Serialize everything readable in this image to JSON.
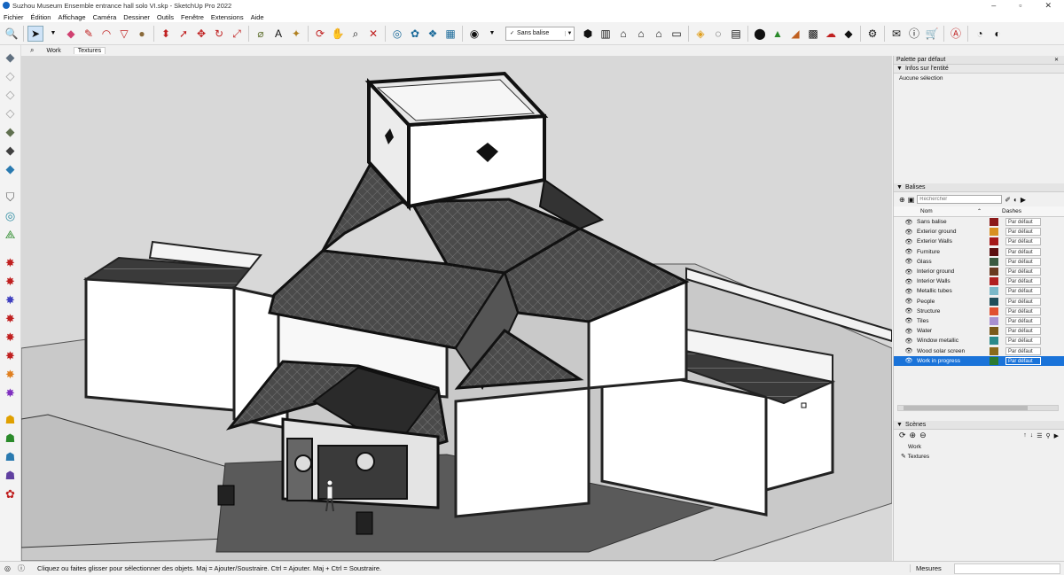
{
  "window": {
    "title": "Suzhou Museum Ensemble entrance hall solo VI.skp - SketchUp Pro 2022",
    "minimize": "–",
    "maximize": "▫",
    "close": "✕"
  },
  "menu": [
    "Fichier",
    "Édition",
    "Affichage",
    "Caméra",
    "Dessiner",
    "Outils",
    "Fenêtre",
    "Extensions",
    "Aide"
  ],
  "toolbar": {
    "tag_select_value": "Sans balise"
  },
  "tabs": [
    "Work",
    "Textures"
  ],
  "panel": {
    "title": "Palette par défaut",
    "entity_info": {
      "header": "Infos sur l'entité",
      "value": "Aucune sélection"
    },
    "tags": {
      "header": "Balises",
      "search_placeholder": "Rechercher",
      "col_name": "Nom",
      "col_dashes": "Dashes",
      "rows": [
        {
          "name": "Sans balise",
          "color": "#8b1a1a",
          "dashes": "Par défaut"
        },
        {
          "name": "Exterior ground",
          "color": "#d89020",
          "dashes": "Par défaut"
        },
        {
          "name": "Exterior Walls",
          "color": "#a51818",
          "dashes": "Par défaut"
        },
        {
          "name": "Furniture",
          "color": "#5c1010",
          "dashes": "Par défaut"
        },
        {
          "name": "Glass",
          "color": "#3a5a40",
          "dashes": "Par défaut"
        },
        {
          "name": "Interior ground",
          "color": "#6a3a20",
          "dashes": "Par défaut"
        },
        {
          "name": "Interior Walls",
          "color": "#b02020",
          "dashes": "Par défaut"
        },
        {
          "name": "Metallic tubes",
          "color": "#7ab8c8",
          "dashes": "Par défaut"
        },
        {
          "name": "People",
          "color": "#1f4e5a",
          "dashes": "Par défaut"
        },
        {
          "name": "Structure",
          "color": "#e05030",
          "dashes": "Par défaut"
        },
        {
          "name": "Tiles",
          "color": "#a890d0",
          "dashes": "Par défaut"
        },
        {
          "name": "Water",
          "color": "#7a5a1a",
          "dashes": "Par défaut"
        },
        {
          "name": "Window metallic",
          "color": "#2a8a8a",
          "dashes": "Par défaut"
        },
        {
          "name": "Wood solar screen",
          "color": "#8a6a1a",
          "dashes": "Par défaut"
        },
        {
          "name": "Work in progress",
          "color": "#2a7a30",
          "dashes": "Par défaut",
          "selected": true
        }
      ]
    },
    "scenes": {
      "header": "Scènes",
      "items": [
        "Work",
        "Textures"
      ]
    }
  },
  "status": {
    "hint": "Cliquez ou faites glisser pour sélectionner des objets. Maj = Ajouter/Soustraire. Ctrl = Ajouter. Maj + Ctrl = Soustraire.",
    "measures_label": "Mesures"
  }
}
